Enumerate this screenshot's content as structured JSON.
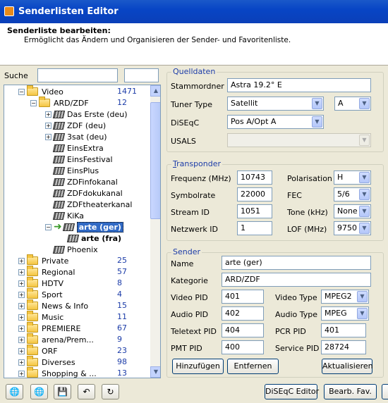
{
  "window": {
    "title": "Senderlisten Editor"
  },
  "header": {
    "title": "Senderliste bearbeiten:",
    "subtitle": "Ermöglicht das Ändern und Organisieren der Sender- und Favoritenliste."
  },
  "search": {
    "label": "Suche",
    "value": "",
    "value2": ""
  },
  "tree": {
    "items": [
      {
        "label": "Video",
        "count": "1471",
        "expander": "minus"
      },
      {
        "label": "ARD/ZDF",
        "count": "12",
        "expander": "minus"
      },
      {
        "label": "Das Erste (deu)",
        "expander": "plus"
      },
      {
        "label": "ZDF (deu)",
        "expander": "plus"
      },
      {
        "label": "3sat (deu)",
        "expander": "plus"
      },
      {
        "label": "EinsExtra",
        "expander": ""
      },
      {
        "label": "EinsFestival",
        "expander": ""
      },
      {
        "label": "EinsPlus",
        "expander": ""
      },
      {
        "label": "ZDFinfokanal",
        "expander": ""
      },
      {
        "label": "ZDFdokukanal",
        "expander": ""
      },
      {
        "label": "ZDFtheaterkanal",
        "expander": ""
      },
      {
        "label": "KiKa",
        "expander": ""
      },
      {
        "label": "arte (ger)",
        "expander": "minus"
      },
      {
        "label": "arte (fra)",
        "expander": ""
      },
      {
        "label": "Phoenix",
        "expander": ""
      },
      {
        "label": "Private",
        "count": "25",
        "expander": "plus"
      },
      {
        "label": "Regional",
        "count": "57",
        "expander": "plus"
      },
      {
        "label": "HDTV",
        "count": "8",
        "expander": "plus"
      },
      {
        "label": "Sport",
        "count": "4",
        "expander": "plus"
      },
      {
        "label": "News & Info",
        "count": "15",
        "expander": "plus"
      },
      {
        "label": "Music",
        "count": "11",
        "expander": "plus"
      },
      {
        "label": "PREMIERE",
        "count": "67",
        "expander": "plus"
      },
      {
        "label": "arena/Prem...",
        "count": "9",
        "expander": "plus"
      },
      {
        "label": "ORF",
        "count": "23",
        "expander": "plus"
      },
      {
        "label": "Diverses",
        "count": "98",
        "expander": "plus"
      },
      {
        "label": "Shopping & ...",
        "count": "13",
        "expander": "plus"
      }
    ]
  },
  "quelldaten": {
    "legend": "Quelldaten",
    "stammordner_label": "Stammordner",
    "stammordner": "Astra 19.2° E",
    "tunertype_label": "Tuner Type",
    "tunertype": "Satellit",
    "tuner": "A",
    "diseqc_label": "DiSEqC",
    "diseqc": "Pos A/Opt A",
    "usals_label": "USALS",
    "usals": ""
  },
  "transponder": {
    "legend": "Transponder",
    "freq_label": "Frequenz (MHz)",
    "freq": "10743",
    "pol_label": "Polarisation",
    "pol": "H",
    "symb_label": "Symbolrate",
    "symb": "22000",
    "fec_label": "FEC",
    "fec": "5/6",
    "stream_label": "Stream ID",
    "stream": "1051",
    "tone_label": "Tone (kHz)",
    "tone": "None",
    "netz_label": "Netzwerk ID",
    "netz": "1",
    "lof_label": "LOF  (MHz)",
    "lof": "9750"
  },
  "sender": {
    "legend": "Sender",
    "name_label": "Name",
    "name": "arte (ger)",
    "kat_label": "Kategorie",
    "kat": "ARD/ZDF",
    "vpid_label": "Video PID",
    "vpid": "401",
    "vtype_label": "Video Type",
    "vtype": "MPEG2",
    "apid_label": "Audio PID",
    "apid": "402",
    "atype_label": "Audio Type",
    "atype": "MPEG",
    "tpid_label": "Teletext PID",
    "tpid": "404",
    "pcr_label": "PCR PID",
    "pcr": "401",
    "pmt_label": "PMT PID",
    "pmt": "400",
    "sid_label": "Service PID",
    "sid": "28724"
  },
  "buttons": {
    "add": "Hinzufügen",
    "remove": "Entfernen",
    "update": "Aktualisieren",
    "diseqc_editor": "DiSEqC Editor",
    "bearb_fav": "Bearb. Fav."
  },
  "toolbar": [
    "globe-back-icon",
    "globe-forward-icon",
    "save-icon",
    "undo-icon",
    "refresh-icon"
  ],
  "colors": {
    "titlebar": "#0a3fb8",
    "selection": "#316ac5",
    "group_label": "#1c3ca8"
  }
}
